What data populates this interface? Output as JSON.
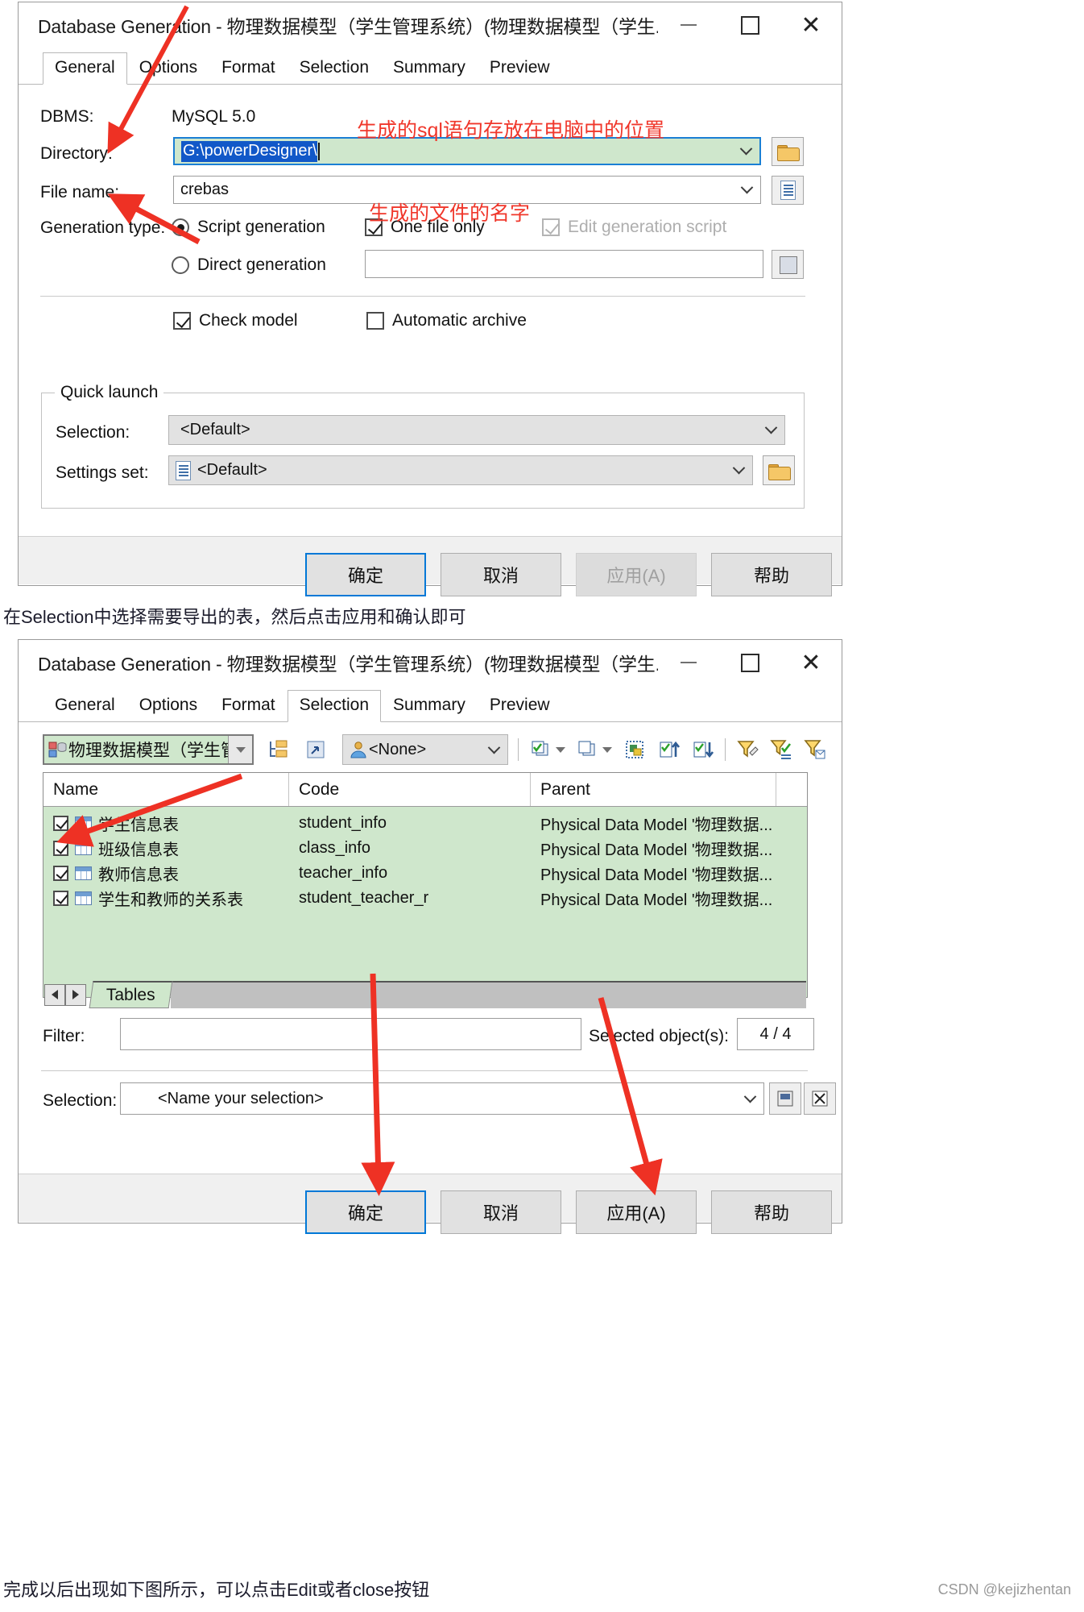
{
  "dialog1": {
    "title": "Database Generation - 物理数据模型（学生管理系统）(物理数据模型（学生...",
    "window_controls": {
      "minimize": "−",
      "maximize": "□",
      "close": "✕"
    },
    "tabs": [
      {
        "label": "General",
        "active": true
      },
      {
        "label": "Options",
        "active": false
      },
      {
        "label": "Format",
        "active": false
      },
      {
        "label": "Selection",
        "active": false
      },
      {
        "label": "Summary",
        "active": false
      },
      {
        "label": "Preview",
        "active": false
      }
    ],
    "fields": {
      "dbms_label": "DBMS:",
      "dbms_value": "MySQL 5.0",
      "directory_label": "Directory:",
      "directory_value": "G:\\powerDesigner\\",
      "filename_label": "File name:",
      "filename_value": "crebas",
      "generation_type_label": "Generation type:",
      "script_generation_label": "Script generation",
      "script_generation_checked": true,
      "direct_generation_label": "Direct generation",
      "direct_generation_checked": false,
      "direct_generation_value": "",
      "one_file_only_label": "One file only",
      "one_file_only_checked": true,
      "edit_generation_script_label": "Edit generation script",
      "edit_generation_script_checked": true,
      "edit_generation_script_disabled": true,
      "check_model_label": "Check model",
      "check_model_checked": true,
      "automatic_archive_label": "Automatic archive",
      "automatic_archive_checked": false
    },
    "quick_launch": {
      "legend": "Quick launch",
      "selection_label": "Selection:",
      "selection_value": "<Default>",
      "settings_set_label": "Settings set:",
      "settings_set_value": "<Default>"
    },
    "buttons": {
      "ok": "确定",
      "cancel": "取消",
      "apply": "应用(A)",
      "help": "帮助"
    },
    "annotations": {
      "sql_location": "生成的sql语句存放在电脑中的位置",
      "file_name": "生成的文件的名字"
    }
  },
  "between_text": "在Selection中选择需要导出的表，然后点击应用和确认即可",
  "dialog2": {
    "title": "Database Generation - 物理数据模型（学生管理系统）(物理数据模型（学生...",
    "window_controls": {
      "minimize": "−",
      "maximize": "□",
      "close": "✕"
    },
    "tabs": [
      {
        "label": "General",
        "active": false
      },
      {
        "label": "Options",
        "active": false
      },
      {
        "label": "Format",
        "active": false
      },
      {
        "label": "Selection",
        "active": true
      },
      {
        "label": "Summary",
        "active": false
      },
      {
        "label": "Preview",
        "active": false
      }
    ],
    "toolbar": {
      "model_combo_value": "物理数据模型（学生管",
      "user_combo_value": "<None>",
      "icons": [
        "model-tree-icon",
        "open-model-icon",
        "user-icon",
        "select-all-icon",
        "select-all-dropdown-icon",
        "deselect-all-icon",
        "deselect-all-dropdown-icon",
        "invert-selection-icon",
        "select-from-list-icon",
        "sort-selection-icon",
        "filter-icon",
        "apply-filter-icon",
        "clear-filter-icon"
      ]
    },
    "grid": {
      "columns": [
        "Name",
        "Code",
        "Parent"
      ],
      "rows": [
        {
          "checked": true,
          "name": "学生信息表",
          "code": "student_info",
          "parent": "Physical Data Model '物理数据..."
        },
        {
          "checked": true,
          "name": "班级信息表",
          "code": "class_info",
          "parent": "Physical Data Model '物理数据..."
        },
        {
          "checked": true,
          "name": "教师信息表",
          "code": "teacher_info",
          "parent": "Physical Data Model '物理数据..."
        },
        {
          "checked": true,
          "name": "学生和教师的关系表",
          "code": "student_teacher_r",
          "parent": "Physical Data Model '物理数据..."
        }
      ],
      "sheet_tab": "Tables"
    },
    "footer_fields": {
      "filter_label": "Filter:",
      "filter_value": "",
      "selected_objects_label": "Selected object(s):",
      "selected_objects_value": "4 / 4",
      "selection_label": "Selection:",
      "selection_value": "<Name your selection>"
    },
    "buttons": {
      "ok": "确定",
      "cancel": "取消",
      "apply": "应用(A)",
      "help": "帮助"
    }
  },
  "bottom_text": "完成以后出现如下图所示，可以点击Edit或者close按钮",
  "watermark": "CSDN @kejizhentan",
  "colors": {
    "accent_blue": "#0078d7",
    "selection_blue": "#1158c8",
    "highlight_green": "#cfe7cc",
    "annotation_red": "#f0372b",
    "title_border": "#b07b4f"
  }
}
